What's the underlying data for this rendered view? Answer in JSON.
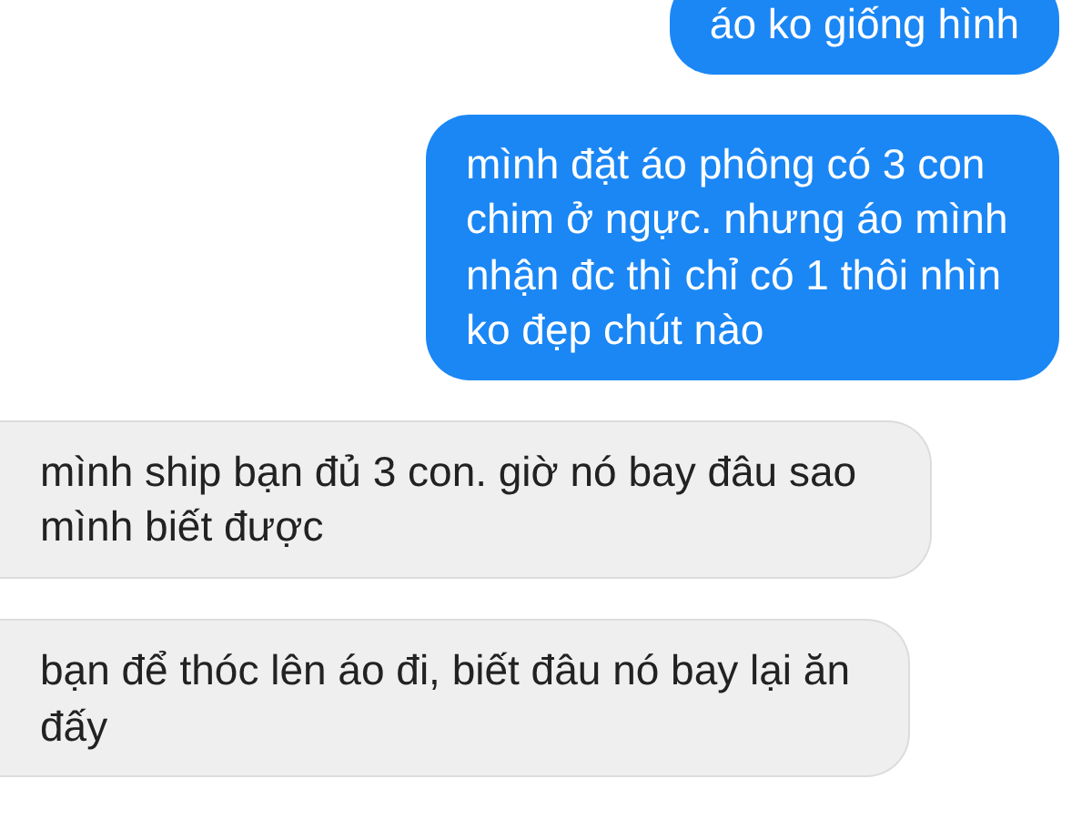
{
  "messages": [
    {
      "kind": "sent",
      "text": "áo ko giống hình"
    },
    {
      "kind": "sent",
      "text": "mình đặt áo phông có 3 con chim ở ngực. nhưng áo mình nhận đc thì chỉ có 1 thôi nhìn ko đẹp chút nào"
    },
    {
      "kind": "received",
      "text": "mình ship bạn đủ 3 con. giờ nó bay đâu sao mình biết được"
    },
    {
      "kind": "received",
      "text": "bạn để thóc lên áo đi, biết đâu nó bay lại ăn đấy"
    }
  ]
}
